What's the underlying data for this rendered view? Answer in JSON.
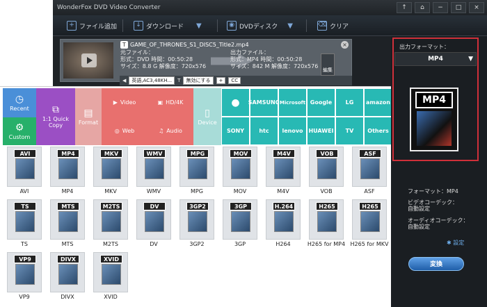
{
  "window": {
    "title": "WonderFox DVD Video Converter",
    "controls": [
      "↑",
      "⌂",
      "−",
      "□",
      "×"
    ]
  },
  "toolbar": {
    "add_file": "ファイル追加",
    "download": "ダウンロード",
    "dvd_disc": "DVDディスク",
    "clear": "クリア"
  },
  "task": {
    "filename": "GAME_OF_THRONES_S1_DISC5_Title2.mp4",
    "source": {
      "title": "元ファイル：",
      "format": "形式：DVD",
      "duration": "時間：00:50:28",
      "size": "サイズ：8.8 G",
      "resolution": "解像度：720x576"
    },
    "output": {
      "title": "出力ファイル：",
      "format": "形式：MP4",
      "duration": "時間：00:50:28",
      "size": "サイズ：842 M",
      "resolution": "解像度：720x576"
    },
    "edit": "編集",
    "audio_track": "英語,AC3,48KH...",
    "subtitle": "無効にする",
    "add": "+",
    "cc": "CC"
  },
  "categories": {
    "recent": "Recent",
    "custom": "Custom",
    "quick_copy": "1:1 Quick Copy",
    "format": "Format",
    "video": "Video",
    "hd": "HD/4K",
    "web": "Web",
    "audio": "Audio",
    "device": "Device"
  },
  "brands": [
    "",
    "SAMSUNG",
    "Microsoft",
    "Google",
    "LG",
    "amazon",
    "SONY",
    "htc",
    "lenovo",
    "HUAWEI",
    "TV",
    "Others"
  ],
  "formats": [
    {
      "tag": "AVI",
      "label": "AVI"
    },
    {
      "tag": "MP4",
      "label": "MP4"
    },
    {
      "tag": "MKV",
      "label": "MKV"
    },
    {
      "tag": "WMV",
      "label": "WMV"
    },
    {
      "tag": "MPG",
      "label": "MPG"
    },
    {
      "tag": "MOV",
      "label": "MOV"
    },
    {
      "tag": "M4V",
      "label": "M4V"
    },
    {
      "tag": "VOB",
      "label": "VOB"
    },
    {
      "tag": "ASF",
      "label": "ASF"
    },
    {
      "tag": "TS",
      "label": "TS"
    },
    {
      "tag": "MTS",
      "label": "MTS"
    },
    {
      "tag": "M2TS",
      "label": "M2TS"
    },
    {
      "tag": "DV",
      "label": "DV"
    },
    {
      "tag": "3GP2",
      "label": "3GP2"
    },
    {
      "tag": "3GP",
      "label": "3GP"
    },
    {
      "tag": "H.264",
      "label": "H264"
    },
    {
      "tag": "H265",
      "label": "H265 for MP4"
    },
    {
      "tag": "H265",
      "label": "H265 for MKV"
    },
    {
      "tag": "VP9",
      "label": "VP9"
    },
    {
      "tag": "DIVX",
      "label": "DIVX"
    },
    {
      "tag": "XVID",
      "label": "XVID"
    }
  ],
  "right": {
    "output_format_label": "出力フォーマット：",
    "selected": "MP4",
    "big_tag": "MP4",
    "format_info": "フォーマット：MP4",
    "video_codec": "ビデオコーデック：",
    "video_codec_val": "自動設定",
    "audio_codec": "オーディオコーデック：",
    "audio_codec_val": "自動設定",
    "settings": "設定",
    "convert": "変換"
  },
  "colors": {
    "teal": "#28b9b4",
    "purple": "#9b4fc4",
    "red": "#e8706e",
    "blue": "#4a8fd8",
    "green": "#27b06a"
  }
}
